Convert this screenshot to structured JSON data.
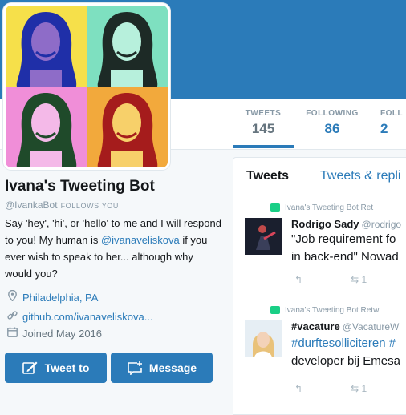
{
  "stats": {
    "tweets": {
      "label": "TWEETS",
      "value": "145"
    },
    "following": {
      "label": "FOLLOWING",
      "value": "86"
    },
    "followers": {
      "label": "FOLL",
      "value": "2"
    }
  },
  "profile": {
    "name": "Ivana's Tweeting Bot",
    "handle": "@IvankaBot",
    "follows_you": "FOLLOWS YOU",
    "bio_part1": "Say 'hey', 'hi', or 'hello' to me and I will respond to you! My human is ",
    "bio_mention": "@ivanaveliskova",
    "bio_part2": " if you ever wish to speak to her... although why would you?",
    "location": "Philadelphia, PA",
    "website": "github.com/ivanaveliskova...",
    "joined": "Joined May 2016"
  },
  "buttons": {
    "tweet_to": "Tweet to",
    "message": "Message"
  },
  "timeline": {
    "tab_tweets": "Tweets",
    "tab_replies": "Tweets & repli",
    "tweets": [
      {
        "retweet_label": "Ivana's Tweeting Bot Ret",
        "author": "Rodrigo Sady",
        "handle": "@rodrigo",
        "line1": "\"Job requirement fo",
        "line2": "in back-end\" Nowad",
        "retweets": "1"
      },
      {
        "retweet_label": "Ivana's Tweeting Bot Retw",
        "author": "#vacature",
        "handle": "@VacatureW",
        "line1": "#durftesolliciteren #",
        "line2": "developer bij Emesa",
        "retweets": "1"
      }
    ]
  },
  "colors": {
    "accent": "#2b7bb9",
    "banner": "#2b7bb9",
    "retweet_green": "#19cf86"
  },
  "icons": {
    "location": "map-pin-icon",
    "website": "link-icon",
    "joined": "calendar-icon",
    "tweet_to": "compose-icon",
    "message": "message-icon",
    "reply": "reply-icon",
    "retweet": "retweet-icon"
  }
}
